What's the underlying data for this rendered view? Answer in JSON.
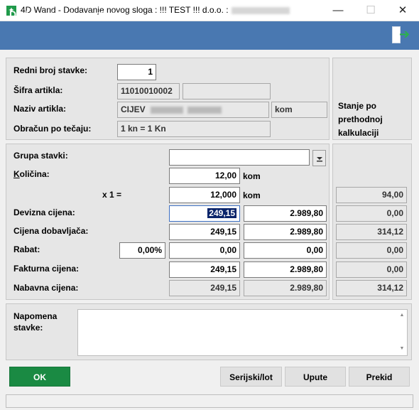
{
  "window": {
    "title": "4D Wand - Dodavanje novog sloga : !!! TEST !!! d.o.o. :",
    "app_icon": "app-icon-green"
  },
  "header": {
    "title": "Dodavanje novog sloga",
    "exit_icon": "exit-arrow-icon",
    "accent": "#4978b1"
  },
  "top_section": {
    "redni_broj_label": "Redni broj stavke:",
    "redni_broj_value": "1",
    "sifra_label": "Šifra artikla:",
    "sifra_value": "11010010002",
    "sifra_extra": "",
    "naziv_label": "Naziv artikla:",
    "naziv_value": "CIJEV",
    "naziv_unit": "kom",
    "obracun_label": "Obračun po tečaju:",
    "obracun_value": "1 kn  = 1 Kn",
    "stanje_label": "Stanje po prethodnoj kalkulaciji"
  },
  "mid_section": {
    "grupa_label": "Grupa stavki:",
    "grupa_value": "",
    "kolicina_label": "Količina:",
    "kolicina_value": "12,00",
    "kolicina_unit": "kom",
    "x1_label": "x 1 =",
    "x1_value": "12,000",
    "x1_unit": "kom",
    "x1_stanje": "94,00",
    "rows": [
      {
        "label": "Devizna cijena:",
        "v1": "249,15",
        "v2": "2.989,80",
        "v3": "0,00"
      },
      {
        "label": "Cijena dobavljača:",
        "v1": "249,15",
        "v2": "2.989,80",
        "v3": "314,12"
      },
      {
        "label": "Rabat:",
        "pct": "0,00%",
        "v1": "0,00",
        "v2": "0,00",
        "v3": "0,00"
      },
      {
        "label": "Fakturna cijena:",
        "v1": "249,15",
        "v2": "2.989,80",
        "v3": "0,00"
      },
      {
        "label": "Nabavna cijena:",
        "v1": "249,15",
        "v2": "2.989,80",
        "v3": "314,12"
      }
    ]
  },
  "napomena": {
    "label": "Napomena stavke:",
    "value": ""
  },
  "buttons": {
    "ok": "OK",
    "serijski": "Serijski/lot",
    "upute": "Upute",
    "prekid": "Prekid"
  },
  "colors": {
    "ok_green": "#1a8a43",
    "header_blue": "#4978b1"
  }
}
